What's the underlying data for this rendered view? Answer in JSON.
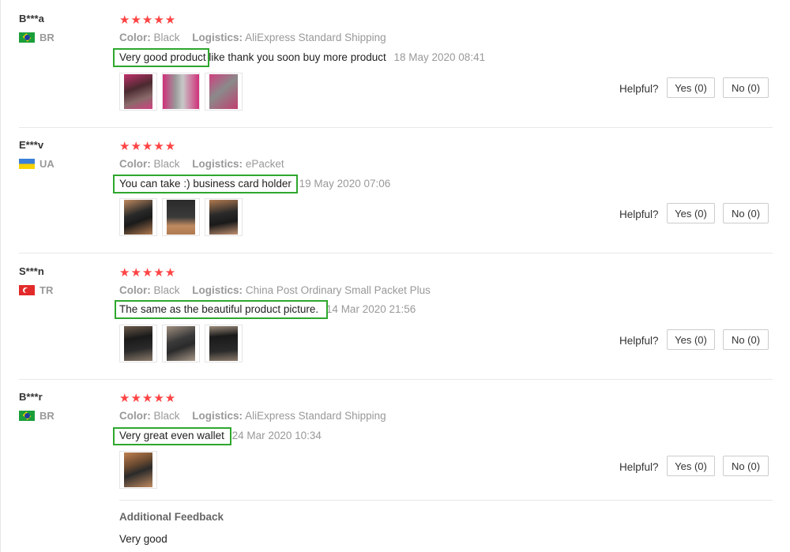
{
  "reviews": [
    {
      "user": "B***a",
      "country": "BR",
      "flag": "brazil",
      "stars": "★★★★★",
      "color_label": "Color:",
      "color_value": "Black",
      "logistics_label": "Logistics:",
      "logistics_value": "AliExpress Standard Shipping",
      "comment_highlight": "Very good product",
      "comment_rest": "like thank you soon buy more product",
      "date": "18 May 2020 08:41",
      "photos": [
        "pink-wallet-photo",
        "pink-wallet-photo",
        "pink-wallet-photo"
      ],
      "helpful_label": "Helpful?",
      "yes_label": "Yes (0)",
      "no_label": "No (0)"
    },
    {
      "user": "E***v",
      "country": "UA",
      "flag": "ukraine",
      "stars": "★★★★★",
      "color_label": "Color:",
      "color_value": "Black",
      "logistics_label": "Logistics:",
      "logistics_value": "ePacket",
      "comment_highlight": "You can take :) business card holder",
      "comment_rest": "",
      "date": "19 May 2020 07:06",
      "photos": [
        "hand-wallet-photo",
        "hand-wallet-photo",
        "hand-wallet-photo"
      ],
      "helpful_label": "Helpful?",
      "yes_label": "Yes (0)",
      "no_label": "No (0)"
    },
    {
      "user": "S***n",
      "country": "TR",
      "flag": "turkey",
      "stars": "★★★★★",
      "color_label": "Color:",
      "color_value": "Black",
      "logistics_label": "Logistics:",
      "logistics_value": "China Post Ordinary Small Packet Plus",
      "comment_highlight": "The same as the beautiful product picture.",
      "comment_rest": "",
      "date": "14 Mar 2020 21:56",
      "photos": [
        "black-wallet-photo",
        "black-wallet-photo",
        "black-wallet-photo"
      ],
      "helpful_label": "Helpful?",
      "yes_label": "Yes (0)",
      "no_label": "No (0)"
    },
    {
      "user": "B***r",
      "country": "BR",
      "flag": "brazil",
      "stars": "★★★★★",
      "color_label": "Color:",
      "color_value": "Black",
      "logistics_label": "Logistics:",
      "logistics_value": "AliExpress Standard Shipping",
      "comment_highlight": "Very great even wallet",
      "comment_rest": "",
      "date": "24 Mar 2020 10:34",
      "photos": [
        "hand-wallet-photo"
      ],
      "helpful_label": "Helpful?",
      "yes_label": "Yes (0)",
      "no_label": "No (0)",
      "additional_title": "Additional Feedback",
      "additional_text": "Very good"
    }
  ],
  "colors": {
    "star": "#f44444",
    "highlight_border": "#2ea72e",
    "muted": "#999999"
  }
}
